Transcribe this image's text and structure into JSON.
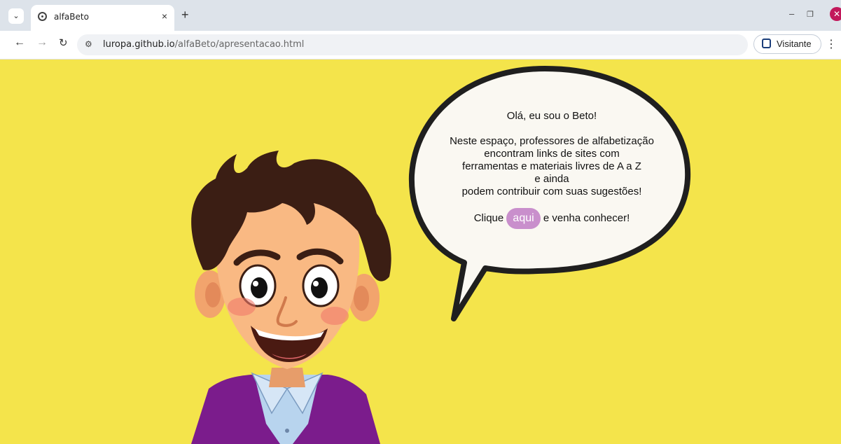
{
  "browser": {
    "tab_title": "alfaBeto",
    "tab_close": "×",
    "new_tab": "+",
    "url_domain": "luropa.github.io",
    "url_path": "/alfaBeto/apresentacao.html",
    "profile_label": "Visitante"
  },
  "bubble": {
    "greeting": "Olá, eu sou o Beto!",
    "line1": "Neste espaço, professores de alfabetização",
    "line2": "encontram links de sites com",
    "line3": "ferramentas e materiais livres de A a Z",
    "line4": "e ainda",
    "line5": "podem contribuir com suas sugestões!",
    "cta_before": "Clique",
    "cta_link": "aqui",
    "cta_after": "e venha conhecer!"
  },
  "colors": {
    "background": "#f4e44b",
    "cta": "#c98fcc",
    "hoodie": "#7b1c8c"
  }
}
